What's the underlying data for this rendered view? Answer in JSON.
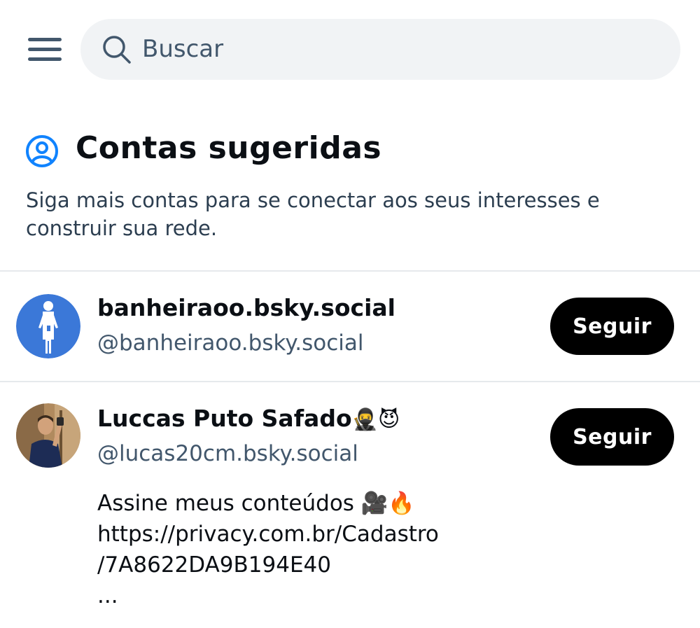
{
  "search": {
    "placeholder": "Buscar",
    "value": ""
  },
  "section": {
    "title": "Contas sugeridas",
    "description": "Siga mais contas para se conectar aos seus interesses e construir sua rede."
  },
  "accounts": [
    {
      "display_name": "banheiraoo.bsky.social",
      "handle": "@banheiraoo.bsky.social",
      "follow_label": "Seguir",
      "avatar_color": "#3b78d8"
    },
    {
      "display_name": "Luccas Puto Safado",
      "name_emojis": "🥷😈",
      "handle": "@lucas20cm.bsky.social",
      "follow_label": "Seguir",
      "bio_lines": [
        "Assine meus conteúdos 🎥🔥",
        "https://privacy.com.br/Cadastro",
        "/7A8622DA9B194E40",
        "..."
      ]
    }
  ],
  "colors": {
    "accent": "#1083fe",
    "muted": "#42576c",
    "button": "#000000",
    "search_bg": "#f1f3f5"
  },
  "icons": {
    "menu": "hamburger-icon",
    "search": "search-icon",
    "section": "user-circle-icon"
  }
}
